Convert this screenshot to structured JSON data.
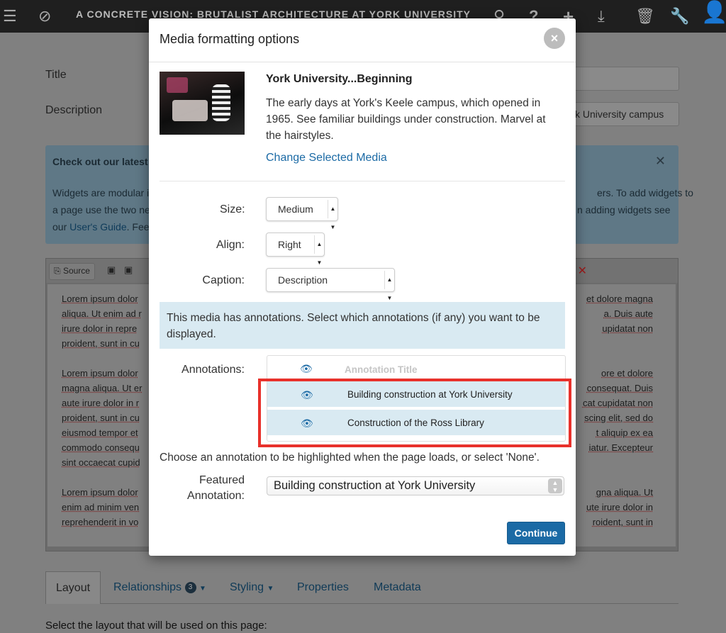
{
  "topbar": {
    "title": "A CONCRETE VISION: BRUTALIST ARCHITECTURE AT YORK UNIVERSITY"
  },
  "page": {
    "title_label": "Title",
    "description_label": "Description",
    "description_value_visible": "k University campus",
    "infobox": {
      "title": "Check out our latest f",
      "line1_left": "Widgets are modular i",
      "line1_right": "ers. To add widgets to",
      "line2_left": "a page use the two nev",
      "line2_right": "n adding widgets see",
      "line3_left_text": "our ",
      "line3_link": "User's Guide",
      "line3_after": ". Feel"
    },
    "editor": {
      "source_label": "Source",
      "left_lines": [
        "Lorem ipsum dolor",
        "aliqua. Ut enim ad r",
        "irure dolor in repre",
        "proident, sunt in cu",
        "Lorem ipsum dolor",
        "magna aliqua. Ut er",
        "aute irure dolor in r",
        "proident, sunt in cu",
        "eiusmod tempor et",
        "commodo consequ",
        "sint occaecat cupid",
        "Lorem ipsum dolor",
        "enim ad minim ven",
        "reprehenderit in vo"
      ],
      "right_lines": [
        "et dolore magna",
        "a. Duis aute",
        "upidatat non",
        "ore et dolore",
        "consequat. Duis",
        "cat cupidatat non",
        "scing elit, sed do",
        "t aliquip ex ea",
        "iatur. Excepteur",
        "gna aliqua. Ut",
        "ute irure dolor in",
        "roident, sunt in"
      ]
    },
    "tabs": [
      {
        "label": "Layout"
      },
      {
        "label": "Relationships",
        "badge": "3"
      },
      {
        "label": "Styling"
      },
      {
        "label": "Properties"
      },
      {
        "label": "Metadata"
      }
    ],
    "layout_note": "Select the layout that will be used on this page:"
  },
  "modal": {
    "title": "Media formatting options",
    "close_glyph": "×",
    "media": {
      "title": "York University...Beginning",
      "description": "The early days at York's Keele campus, which opened in 1965. See familiar buildings under construction. Marvel at the hairstyles.",
      "change_link": "Change Selected Media"
    },
    "size": {
      "label": "Size:",
      "value": "Medium"
    },
    "align": {
      "label": "Align:",
      "value": "Right"
    },
    "caption": {
      "label": "Caption:",
      "value": "Description"
    },
    "notice": "This media has annotations. Select which annotations (if any) you want to be displayed.",
    "annotations": {
      "label": "Annotations:",
      "header_title": "Annotation Title",
      "rows": [
        {
          "title": "Building construction at York University"
        },
        {
          "title": "Construction of the Ross Library"
        }
      ]
    },
    "choose_note": "Choose an annotation to be highlighted when the page loads, or select 'None'.",
    "featured": {
      "label_line1": "Featured",
      "label_line2": "Annotation:",
      "value": "Building construction at York University"
    },
    "continue_label": "Continue"
  },
  "colors": {
    "accent": "#1b6aa5",
    "highlight_border": "#e8312b",
    "notice_bg": "#d9eaf2",
    "topbar_bg": "#1f1f1f"
  },
  "icons": [
    "menu-icon",
    "compass-icon",
    "search-icon",
    "help-icon",
    "add-icon",
    "download-icon",
    "trash-icon",
    "wrench-icon",
    "user-icon",
    "eye-icon",
    "close-icon"
  ]
}
